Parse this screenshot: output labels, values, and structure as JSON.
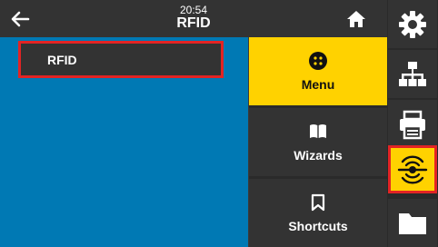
{
  "header": {
    "time": "20:54",
    "title": "RFID",
    "back_icon": "arrow-left-icon",
    "home_icon": "home-icon"
  },
  "main": {
    "items": [
      {
        "label": "RFID"
      }
    ]
  },
  "menu": {
    "items": [
      {
        "label": "Menu",
        "icon": "dots-grid-icon",
        "active": true
      },
      {
        "label": "Wizards",
        "icon": "book-open-icon",
        "active": false
      },
      {
        "label": "Shortcuts",
        "icon": "bookmark-icon",
        "active": false
      }
    ]
  },
  "side_rail": {
    "items": [
      {
        "icon": "gear-icon",
        "active": false
      },
      {
        "icon": "network-icon",
        "active": false
      },
      {
        "icon": "printer-icon",
        "active": false
      },
      {
        "icon": "rfid-icon",
        "active": true
      },
      {
        "icon": "folder-icon",
        "active": false
      }
    ]
  },
  "colors": {
    "accent": "#ffd200",
    "highlight": "#e32424",
    "main_bg": "#0079b4",
    "bar_bg": "#333333"
  }
}
